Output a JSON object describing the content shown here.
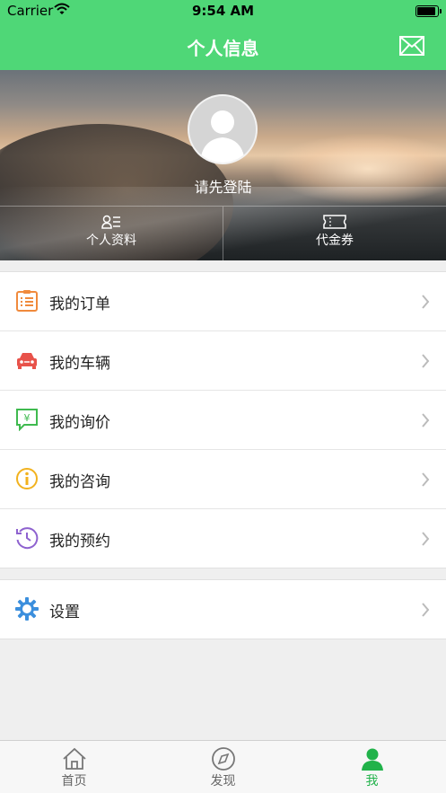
{
  "status_bar": {
    "carrier": "Carrier",
    "time": "9:54 AM",
    "battery_level": 1.0
  },
  "nav": {
    "title": "个人信息",
    "mail_icon": "mail-icon"
  },
  "profile": {
    "login_prompt": "请先登陆",
    "tabs": [
      {
        "label": "个人资料",
        "icon": "profile-card-icon"
      },
      {
        "label": "代金券",
        "icon": "voucher-icon"
      }
    ]
  },
  "menu": [
    {
      "label": "我的订单",
      "icon": "order-list-icon",
      "color": "#f08a3c"
    },
    {
      "label": "我的车辆",
      "icon": "car-icon",
      "color": "#e8524a"
    },
    {
      "label": "我的询价",
      "icon": "yuan-chat-icon",
      "color": "#3fba4f"
    },
    {
      "label": "我的咨询",
      "icon": "info-icon",
      "color": "#f2b21e"
    },
    {
      "label": "我的预约",
      "icon": "history-clock-icon",
      "color": "#8e62cf"
    }
  ],
  "settings": {
    "label": "设置",
    "icon": "gear-icon",
    "color": "#3c8fdd"
  },
  "tabbar": [
    {
      "label": "首页",
      "icon": "home-icon",
      "active": false
    },
    {
      "label": "发现",
      "icon": "compass-icon",
      "active": false
    },
    {
      "label": "我",
      "icon": "user-icon",
      "active": true
    }
  ],
  "colors": {
    "accent": "#4fd777",
    "active_tab": "#21b24a"
  }
}
